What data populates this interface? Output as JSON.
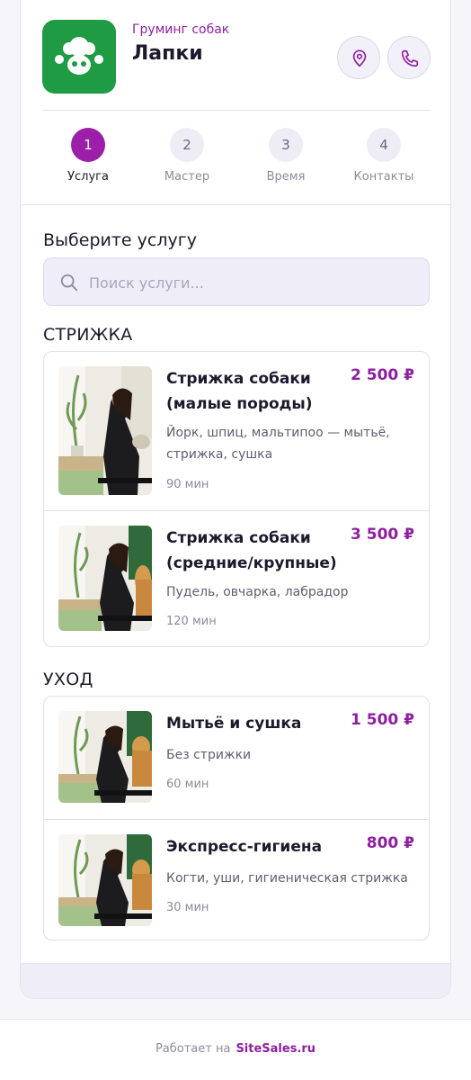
{
  "header": {
    "subtitle": "Груминг собак",
    "title": "Лапки",
    "logo_icon": "paw-icon",
    "map_icon": "map-pin-icon",
    "phone_icon": "phone-icon",
    "brand_color": "#1e9b43",
    "accent_color": "#9b1fa8"
  },
  "steps": [
    {
      "num": "1",
      "label": "Услуга",
      "active": true
    },
    {
      "num": "2",
      "label": "Мастер",
      "active": false
    },
    {
      "num": "3",
      "label": "Время",
      "active": false
    },
    {
      "num": "4",
      "label": "Контакты",
      "active": false
    }
  ],
  "main": {
    "heading": "Выберите услугу",
    "search_placeholder": "Поиск услуги...",
    "search_value": ""
  },
  "categories": [
    {
      "title": "СТРИЖКА",
      "items": [
        {
          "name": "Стрижка собаки (малые породы)",
          "price": "2 500 ₽",
          "desc": "Йорк, шпиц, мальтипоо — мытьё, стрижка, сушка",
          "duration": "90 мин"
        },
        {
          "name": "Стрижка собаки (средние/крупные)",
          "price": "3 500 ₽",
          "desc": "Пудель, овчарка, лабрадор",
          "duration": "120 мин"
        }
      ]
    },
    {
      "title": "УХОД",
      "items": [
        {
          "name": "Мытьё и сушка",
          "price": "1 500 ₽",
          "desc": "Без стрижки",
          "duration": "60 мин"
        },
        {
          "name": "Экспресс-гигиена",
          "price": "800 ₽",
          "desc": "Когти, уши, гигиеническая стрижка",
          "duration": "30 мин"
        }
      ]
    }
  ],
  "footer": {
    "prefix": "Работает на",
    "brand": "SiteSales.ru"
  }
}
